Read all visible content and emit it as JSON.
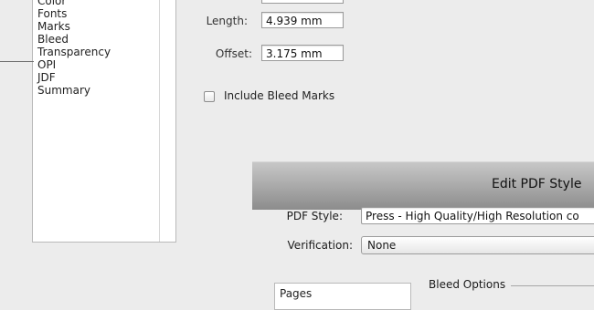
{
  "back_dialog": {
    "categories": [
      "Color",
      "Fonts",
      "Marks",
      "Bleed",
      "Transparency",
      "OPI",
      "JDF",
      "Summary"
    ],
    "length": {
      "label": "Length:",
      "value": "4.939 mm"
    },
    "offset": {
      "label": "Offset:",
      "value": "3.175 mm"
    },
    "include_bleed_marks": {
      "label": "Include Bleed Marks",
      "checked": false
    }
  },
  "front_dialog": {
    "title": "Edit PDF Style",
    "pdf_style": {
      "label": "PDF Style:",
      "value": "Press - High Quality/High Resolution co"
    },
    "verification": {
      "label": "Verification:",
      "value": "None"
    },
    "list_items": [
      "Pages"
    ],
    "bleed_options_label": "Bleed Options"
  }
}
